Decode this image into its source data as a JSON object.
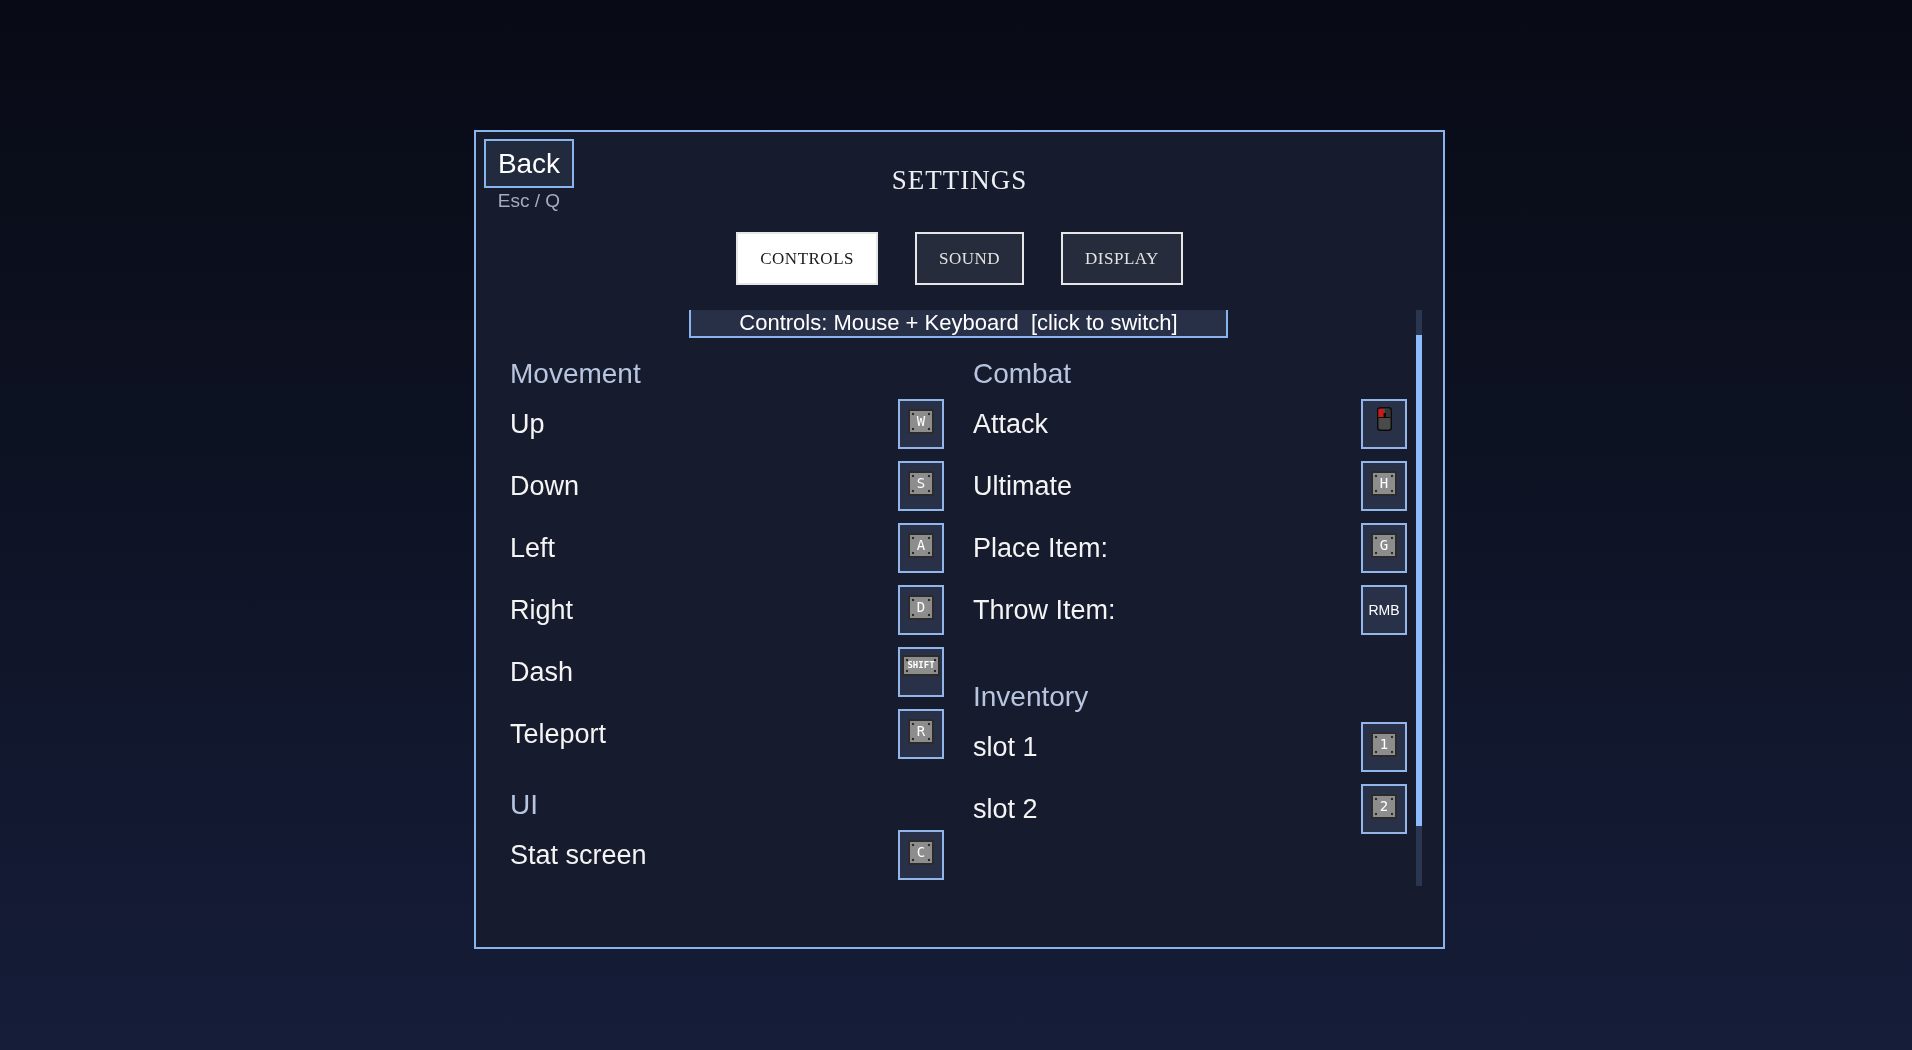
{
  "back_button": {
    "label": "Back",
    "shortcut": "Esc / Q"
  },
  "title": "SETTINGS",
  "tabs": [
    {
      "label": "CONTROLS",
      "selected": true
    },
    {
      "label": "SOUND",
      "selected": false
    },
    {
      "label": "DISPLAY",
      "selected": false
    }
  ],
  "input_mode_toggle": "Controls: Mouse + Keyboard  [click to switch]",
  "columns": [
    {
      "sections": [
        {
          "heading": "Movement",
          "bindings": [
            {
              "action": "Up",
              "kind": "key",
              "key": "W"
            },
            {
              "action": "Down",
              "kind": "key",
              "key": "S"
            },
            {
              "action": "Left",
              "kind": "key",
              "key": "A"
            },
            {
              "action": "Right",
              "kind": "key",
              "key": "D"
            },
            {
              "action": "Dash",
              "kind": "key",
              "key": "SHIFT"
            },
            {
              "action": "Teleport",
              "kind": "key",
              "key": "R"
            }
          ]
        },
        {
          "heading": "UI",
          "bindings": [
            {
              "action": "Stat screen",
              "kind": "key",
              "key": "C"
            }
          ]
        }
      ]
    },
    {
      "sections": [
        {
          "heading": "Combat",
          "bindings": [
            {
              "action": "Attack",
              "kind": "mouse"
            },
            {
              "action": "Ultimate",
              "kind": "key",
              "key": "H"
            },
            {
              "action": "Place Item:",
              "kind": "key",
              "key": "G"
            },
            {
              "action": "Throw Item:",
              "kind": "text",
              "key": "RMB"
            }
          ]
        },
        {
          "heading": "Inventory",
          "bindings": [
            {
              "action": "slot 1",
              "kind": "key",
              "key": "1"
            },
            {
              "action": "slot 2",
              "kind": "key",
              "key": "2"
            }
          ]
        }
      ]
    }
  ]
}
